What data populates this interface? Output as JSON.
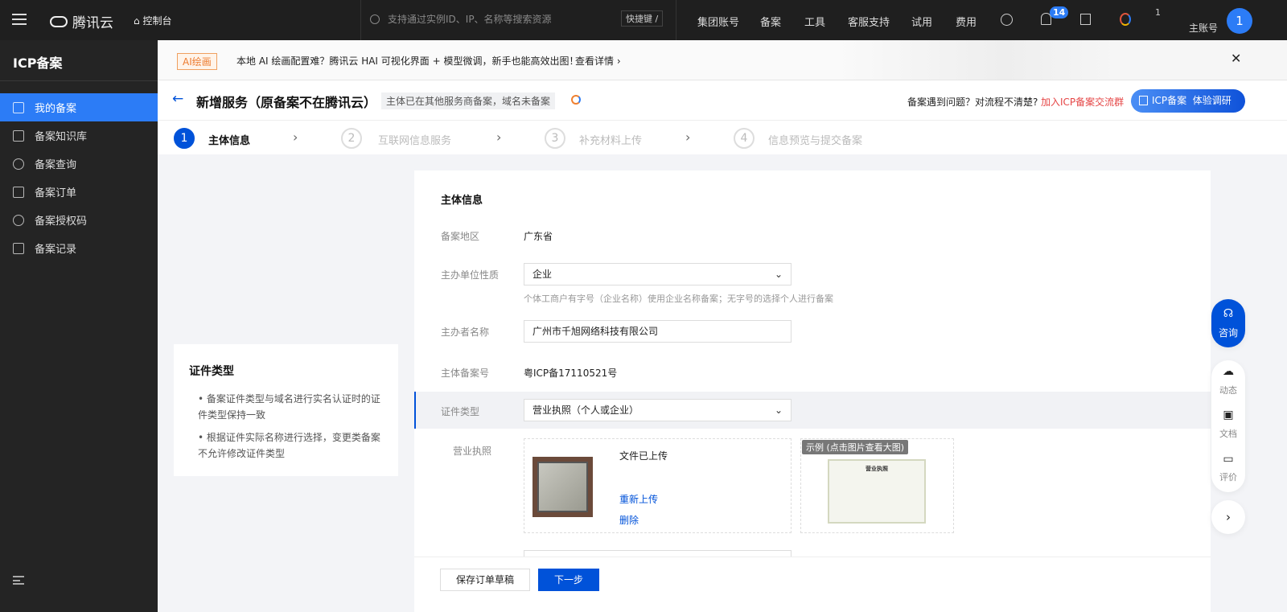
{
  "topbar": {
    "brand": "腾讯云",
    "console": "控制台",
    "search_placeholder": "支持通过实例ID、IP、名称等搜索资源",
    "shortcut": "快捷键 /",
    "nav": [
      "集团账号",
      "备案",
      "工具",
      "客服支持",
      "试用",
      "费用"
    ],
    "bell_badge": "14",
    "account_count": "1",
    "account_label": "主账号",
    "avatar": "1"
  },
  "sidebar": {
    "title": "ICP备案",
    "items": [
      {
        "label": "我的备案"
      },
      {
        "label": "备案知识库"
      },
      {
        "label": "备案查询"
      },
      {
        "label": "备案订单"
      },
      {
        "label": "备案授权码"
      },
      {
        "label": "备案记录"
      }
    ]
  },
  "banner": {
    "tag": "AI绘画",
    "text": "本地 AI 绘画配置难？腾讯云 HAI 可视化界面 + 模型微调，新手也能高效出图！",
    "link": "查看详情"
  },
  "header": {
    "title": "新增服务（原备案不在腾讯云）",
    "tag": "主体已在其他服务商备案，域名未备案",
    "help": "备案遇到问题？对流程不清楚?",
    "help_link": "加入ICP备案交流群",
    "survey_btn_a": "ICP备案",
    "survey_btn_b": "体验调研"
  },
  "steps": [
    {
      "num": "1",
      "label": "主体信息"
    },
    {
      "num": "2",
      "label": "互联网信息服务"
    },
    {
      "num": "3",
      "label": "补充材料上传"
    },
    {
      "num": "4",
      "label": "信息预览与提交备案"
    }
  ],
  "tip": {
    "title": "证件类型",
    "items": [
      "备案证件类型与域名进行实名认证时的证件类型保持一致",
      "根据证件实际名称进行选择，变更类备案不允许修改证件类型"
    ]
  },
  "form": {
    "section_title": "主体信息",
    "region_label": "备案地区",
    "region": "广东省",
    "nature_label": "主办单位性质",
    "nature": "企业",
    "nature_hint": "个体工商户有字号（企业名称）使用企业名称备案；无字号的选择个人进行备案",
    "name_label": "主办者名称",
    "name": "广州市千旭网络科技有限公司",
    "record_label": "主体备案号",
    "record": "粤ICP备17110521号",
    "cert_label": "证件类型",
    "cert": "营业执照（个人或企业）",
    "license_label": "营业执照",
    "uploaded": "文件已上传",
    "reupload": "重新上传",
    "delete": "删除",
    "example": "示例 (点击图片查看大图)",
    "example_title": "营业执照"
  },
  "footer": {
    "save": "保存订单草稿",
    "next": "下一步"
  },
  "float": {
    "consult": "咨询",
    "news": "动态",
    "docs": "文档",
    "rate": "评价"
  },
  "colors": {
    "primary": "#0052d9",
    "sidebar_active": "#2c7cf6",
    "link_red": "#e54545"
  }
}
